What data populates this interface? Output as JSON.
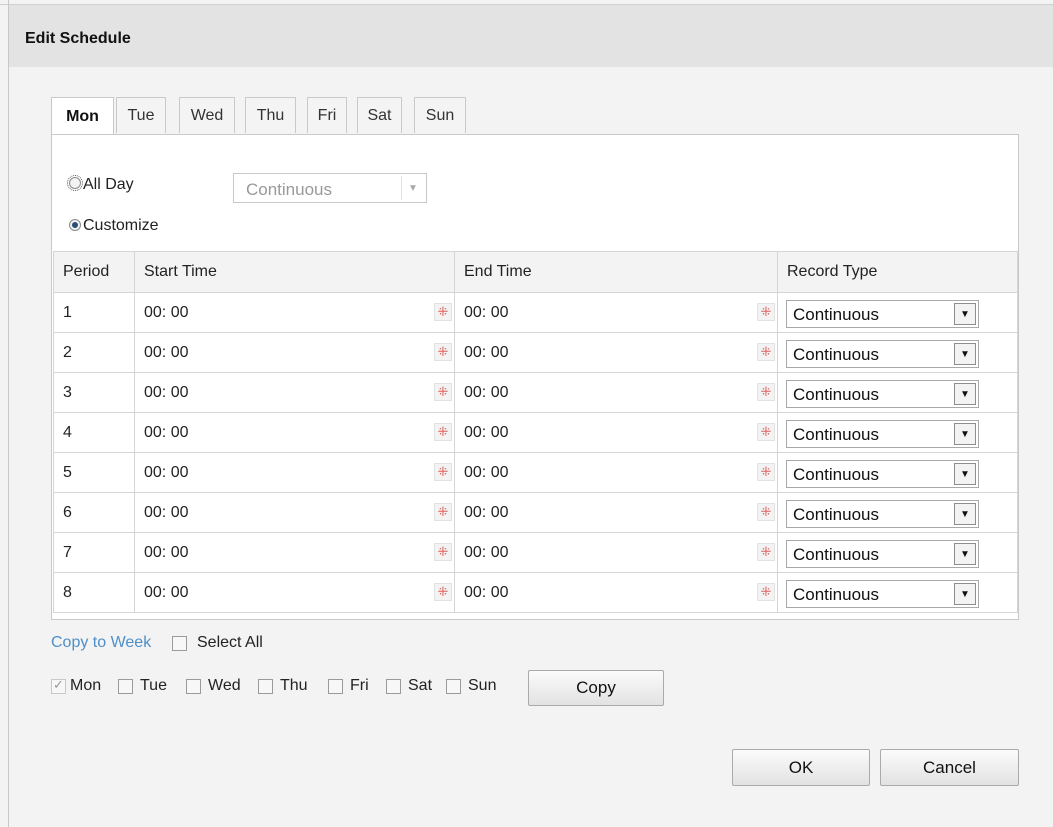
{
  "dialog": {
    "title": "Edit Schedule"
  },
  "tabs": [
    {
      "label": "Mon",
      "active": true
    },
    {
      "label": "Tue",
      "active": false
    },
    {
      "label": "Wed",
      "active": false
    },
    {
      "label": "Thu",
      "active": false
    },
    {
      "label": "Fri",
      "active": false
    },
    {
      "label": "Sat",
      "active": false
    },
    {
      "label": "Sun",
      "active": false
    }
  ],
  "mode": {
    "all_day_label": "All Day",
    "all_day_selected": false,
    "all_day_type": "Continuous",
    "customize_label": "Customize",
    "customize_selected": true
  },
  "table": {
    "headers": {
      "period": "Period",
      "start": "Start Time",
      "end": "End Time",
      "type": "Record Type"
    },
    "rows": [
      {
        "period": "1",
        "start": "00: 00",
        "end": "00: 00",
        "type": "Continuous"
      },
      {
        "period": "2",
        "start": "00: 00",
        "end": "00: 00",
        "type": "Continuous"
      },
      {
        "period": "3",
        "start": "00: 00",
        "end": "00: 00",
        "type": "Continuous"
      },
      {
        "period": "4",
        "start": "00: 00",
        "end": "00: 00",
        "type": "Continuous"
      },
      {
        "period": "5",
        "start": "00: 00",
        "end": "00: 00",
        "type": "Continuous"
      },
      {
        "period": "6",
        "start": "00: 00",
        "end": "00: 00",
        "type": "Continuous"
      },
      {
        "period": "7",
        "start": "00: 00",
        "end": "00: 00",
        "type": "Continuous"
      },
      {
        "period": "8",
        "start": "00: 00",
        "end": "00: 00",
        "type": "Continuous"
      }
    ]
  },
  "copy": {
    "copy_to_week": "Copy to Week",
    "select_all": "Select All",
    "days": [
      {
        "label": "Mon",
        "checked": true,
        "disabled": true
      },
      {
        "label": "Tue",
        "checked": false
      },
      {
        "label": "Wed",
        "checked": false
      },
      {
        "label": "Thu",
        "checked": false
      },
      {
        "label": "Fri",
        "checked": false
      },
      {
        "label": "Sat",
        "checked": false
      },
      {
        "label": "Sun",
        "checked": false
      }
    ],
    "copy_button": "Copy"
  },
  "footer": {
    "ok": "OK",
    "cancel": "Cancel"
  },
  "colors": {
    "link": "#4f8fc9",
    "titlebar": "#e3e3e3",
    "clock_icon": "#e06060"
  }
}
